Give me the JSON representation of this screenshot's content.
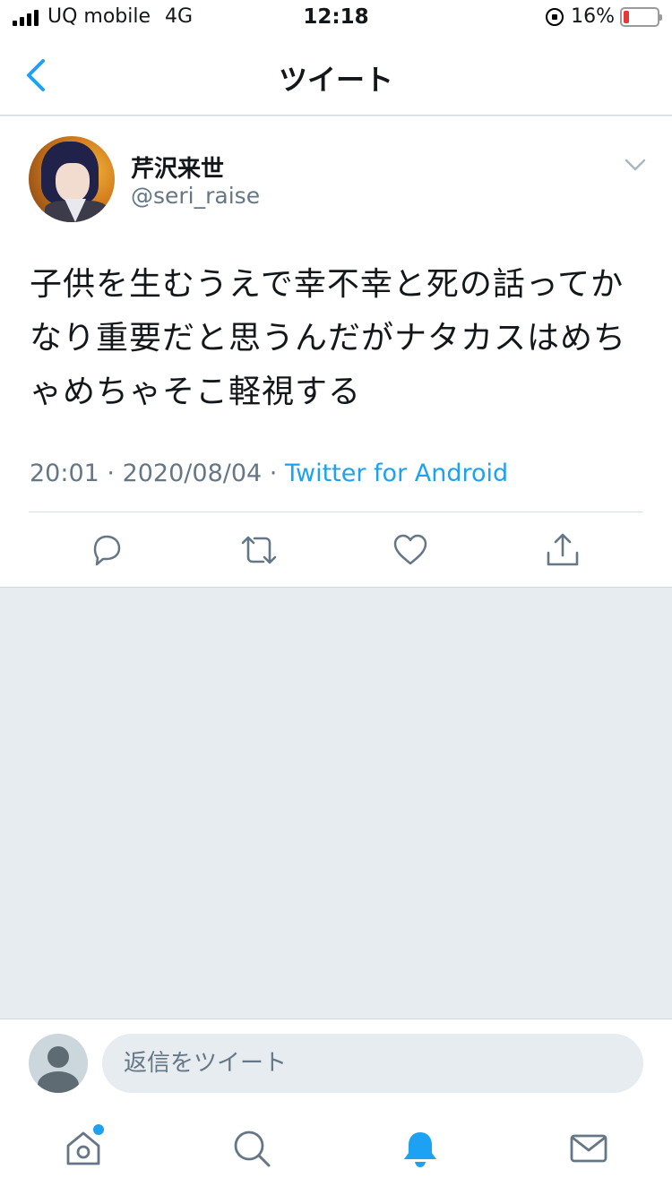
{
  "status_bar": {
    "carrier": "UQ mobile",
    "network": "4G",
    "time": "12:18",
    "battery": "16%",
    "battery_level": 0.16,
    "battery_color": "#e53935"
  },
  "header": {
    "title": "ツイート",
    "back_icon": "chevron-left-icon",
    "accent_color": "#1da1f2"
  },
  "tweet": {
    "display_name": "芹沢来世",
    "handle": "@seri_raise",
    "text": "子供を生むうえで幸不幸と死の話ってかなり重要だと思うんだがナタカスはめちゃめちゃそこ軽視する",
    "time": "20:01",
    "date": "2020/08/04",
    "source": "Twitter for Android",
    "actions": [
      "reply-icon",
      "retweet-icon",
      "like-icon",
      "share-icon"
    ]
  },
  "reply": {
    "placeholder": "返信をツイート"
  },
  "tabbar": {
    "items": [
      "home-icon",
      "search-icon",
      "notifications-icon",
      "messages-icon"
    ],
    "active": "notifications-icon",
    "home_has_dot": true
  }
}
